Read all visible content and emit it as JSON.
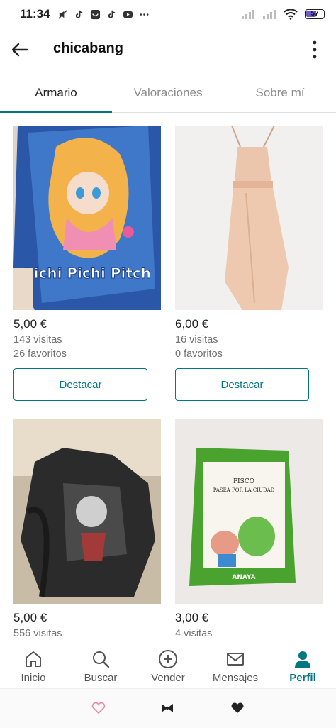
{
  "status_bar": {
    "time": "11:34",
    "battery": "57"
  },
  "header": {
    "title": "chicabang"
  },
  "tabs": [
    {
      "label": "Armario",
      "active": true
    },
    {
      "label": "Valoraciones",
      "active": false
    },
    {
      "label": "Sobre mí",
      "active": false
    }
  ],
  "items": [
    {
      "price": "5,00 €",
      "views": "143 visitas",
      "favs": "26 favoritos",
      "button": "Destacar",
      "image": "manga-book-cover",
      "cover_text": "Pichi Pichi Pitch"
    },
    {
      "price": "6,00 €",
      "views": "16 visitas",
      "favs": "0 favoritos",
      "button": "Destacar",
      "image": "beige-dress"
    },
    {
      "price": "5,00 €",
      "views": "556 visitas",
      "image": "graphic-mesh-top"
    },
    {
      "price": "3,00 €",
      "views": "4 visitas",
      "image": "book-pisco",
      "cover_text": "PISCO PASEA POR LA CIUDAD",
      "cover_brand": "ANAYA"
    }
  ],
  "bottom_nav": [
    {
      "label": "Inicio",
      "icon": "home-icon",
      "active": false
    },
    {
      "label": "Buscar",
      "icon": "search-icon",
      "active": false
    },
    {
      "label": "Vender",
      "icon": "plus-circle-icon",
      "active": false
    },
    {
      "label": "Mensajes",
      "icon": "mail-icon",
      "active": false
    },
    {
      "label": "Perfil",
      "icon": "person-icon",
      "active": true
    }
  ],
  "colors": {
    "accent": "#007782",
    "text": "#222222",
    "muted": "#707070"
  }
}
